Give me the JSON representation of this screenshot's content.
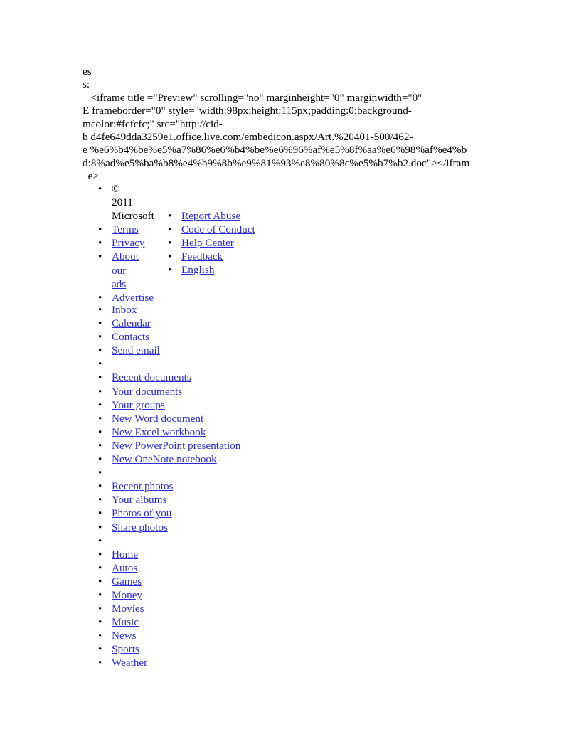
{
  "document": {
    "embed_block": {
      "lines": [
        "es",
        "s:",
        "   <iframe title =\"Preview\" scrolling=\"no\" marginheight=\"0\" marginwidth=\"0\"",
        "E frameborder=\"0\" style=\"width:98px;height:115px;padding:0;background-",
        "mcolor:#fcfcfc;\" src=\"http://cid-",
        "b d4fe649dda3259e1.office.live.com/embedicon.aspx/Art.%20401-500/462-",
        "e %e6%b4%be%e5%a7%86%e6%b4%be%e6%96%af%e5%8f%aa%e6%98%af%e4%b",
        "d:8%ad%e5%ba%b8%e4%b9%8b%e9%81%93%e8%80%8c%e5%b7%b2.doc\"></ifram",
        "  e>"
      ]
    },
    "footer_left_column": {
      "items": [
        {
          "label": "© 2011 Microsoft",
          "link": false
        },
        {
          "label": "Terms",
          "link": true
        },
        {
          "label": "Privacy",
          "link": true
        },
        {
          "label": "About our ads",
          "link": true
        },
        {
          "label": "Advertise",
          "link": true
        },
        {
          "label": "Inbox",
          "link": true
        },
        {
          "label": "Calendar",
          "link": true
        },
        {
          "label": "Contacts",
          "link": true
        },
        {
          "label": "Send email",
          "link": true
        }
      ]
    },
    "footer_right_column": {
      "items": [
        {
          "label": "Report Abuse",
          "link": true
        },
        {
          "label": "Code of Conduct",
          "link": true
        },
        {
          "label": "Help Center",
          "link": true
        },
        {
          "label": "Feedback",
          "link": true
        },
        {
          "label": "English",
          "link": true
        }
      ]
    },
    "mail_group": {
      "items": [
        {
          "label": "Inbox",
          "link": true
        },
        {
          "label": "Calendar",
          "link": true
        },
        {
          "label": "Contacts",
          "link": true
        },
        {
          "label": "Send email",
          "link": true
        }
      ]
    },
    "documents_group": {
      "items": [
        {
          "label": "Recent documents",
          "link": true
        },
        {
          "label": "Your documents",
          "link": true
        },
        {
          "label": "Your groups",
          "link": true
        },
        {
          "label": "New Word document",
          "link": true
        },
        {
          "label": "New Excel workbook",
          "link": true
        },
        {
          "label": "New PowerPoint presentation",
          "link": true
        },
        {
          "label": "New OneNote notebook",
          "link": true
        }
      ]
    },
    "photos_group": {
      "items": [
        {
          "label": "Recent photos",
          "link": true
        },
        {
          "label": "Your albums",
          "link": true
        },
        {
          "label": "Photos of you",
          "link": true
        },
        {
          "label": "Share photos",
          "link": true
        }
      ]
    },
    "msn_group": {
      "items": [
        {
          "label": "Home",
          "link": true
        },
        {
          "label": "Autos",
          "link": true
        },
        {
          "label": "Games",
          "link": true
        },
        {
          "label": "Money",
          "link": true
        },
        {
          "label": "Movies",
          "link": true
        },
        {
          "label": "Music",
          "link": true
        },
        {
          "label": "News",
          "link": true
        },
        {
          "label": "Sports",
          "link": true
        },
        {
          "label": "Weather",
          "link": true
        }
      ]
    },
    "colors": {
      "link": "#2b2bd4",
      "text": "#000000",
      "background": "#ffffff"
    }
  }
}
